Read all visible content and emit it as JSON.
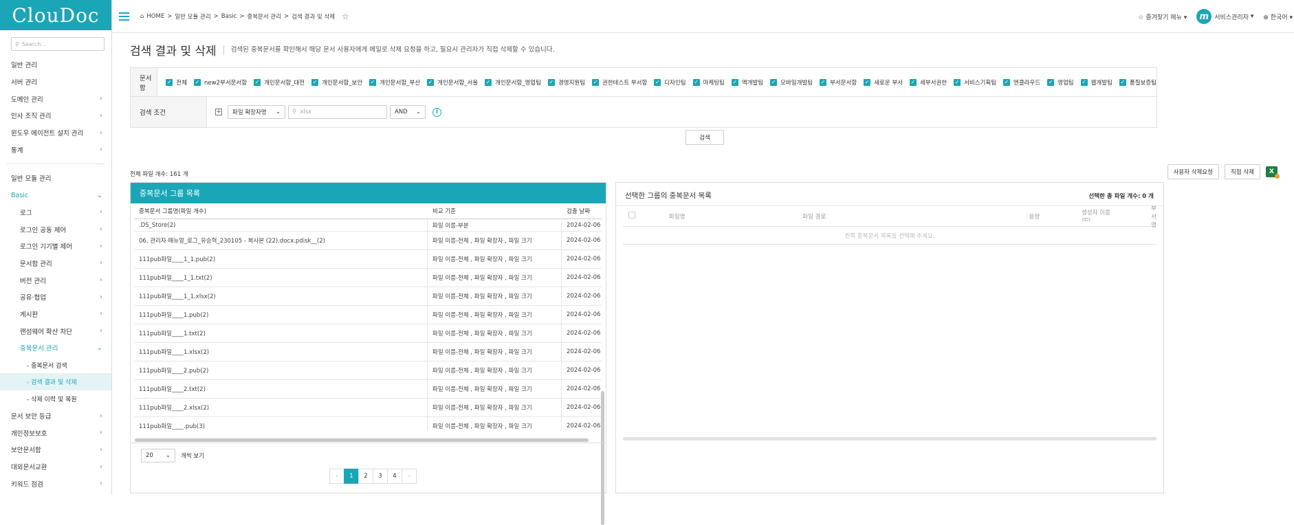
{
  "app": {
    "logo": "ClouDoc"
  },
  "sidebar": {
    "search_placeholder": "Search...",
    "items": [
      {
        "label": "일반 관리",
        "chevron": false
      },
      {
        "label": "서버 관리",
        "chevron": false
      },
      {
        "label": "도메인 관리",
        "chevron": true
      },
      {
        "label": "인사 조직 관리",
        "chevron": true
      },
      {
        "label": "윈도우 에이전트 설치 관리",
        "chevron": true
      },
      {
        "label": "통계",
        "chevron": true
      }
    ],
    "section2": "일반 모듈 관리",
    "basic": {
      "label": "Basic"
    },
    "basic_items": [
      {
        "label": "로그"
      },
      {
        "label": "로그인 공동 제어"
      },
      {
        "label": "로그인 기기별 제어"
      },
      {
        "label": "문서함 관리"
      },
      {
        "label": "버전 관리"
      },
      {
        "label": "공유·협업"
      },
      {
        "label": "게시판"
      },
      {
        "label": "랜섬웨어 확산 차단"
      }
    ],
    "dup": {
      "label": "중복문서 관리"
    },
    "dup_items": [
      "- 중복문서 검색",
      "- 검색 결과 및 삭제",
      "- 삭제 이력 및 복원"
    ],
    "bottom_items": [
      {
        "label": "문서 보안 등급"
      },
      {
        "label": "개인정보보호"
      },
      {
        "label": "보안문서함"
      },
      {
        "label": "대외문서교환"
      },
      {
        "label": "키워드 점검"
      }
    ]
  },
  "header": {
    "breadcrumb": [
      "HOME",
      ">",
      "일반 모듈 관리",
      ">",
      "Basic",
      ">",
      "중복문서 관리",
      ">",
      "검색 결과 및 삭제"
    ],
    "favorites": "즐겨찾기 메뉴",
    "avatar_letter": "m",
    "user": "서비스관리자",
    "language": "한국어"
  },
  "page": {
    "title": "검색 결과 및 삭제",
    "description": "검색된 중복문서를 확인해서 해당 문서 사용자에게 메일로 삭제 요청을 하고, 필요시 관리자가 직접 삭제할 수 있습니다."
  },
  "form": {
    "docbox_label": "문서함",
    "docboxes": [
      "전체",
      "new2부서문서함",
      "개인문서함_대전",
      "개인문서함_보안",
      "개인문서함_부산",
      "개인문서함_서울",
      "개인문서함_영업팀",
      "경영지원팀",
      "권한테스트 부서함",
      "디자인팀",
      "마케팅팀",
      "맥개발팀",
      "모바일개발팀",
      "부서문서함",
      "새로운 부서",
      "세부서권한",
      "서비스기획팀",
      "엔클라우드",
      "영업팀",
      "웹개발팀",
      "품질보증팀"
    ],
    "condition_label": "검색 조건",
    "field_select": "파일 확장자명",
    "value_placeholder": "xlsx",
    "operator_select": "AND",
    "search_button": "검색"
  },
  "results": {
    "total": "전체 파일 개수: 161 개",
    "request_delete_button": "사용자 삭제요청",
    "direct_delete_button": "직접 삭제",
    "excel_icon": "X"
  },
  "left_panel": {
    "title": "중복문서 그룹 목록",
    "columns": [
      "중복문서 그룹명(파일 개수)",
      "비교 기준",
      "검출 날짜"
    ],
    "rows": [
      [
        ".DS_Store(2)",
        "파일 이름-부분",
        "2024-02-06"
      ],
      [
        "06. 관리자 매뉴얼_로그_유승혁_230105 - 복사본 (22).docx.pdisk__(2)",
        "파일 이름-전체 , 파일 확장자 , 파일 크기",
        "2024-02-06"
      ],
      [
        "111pub파일____1_1.pub(2)",
        "파일 이름-전체 , 파일 확장자 , 파일 크기",
        "2024-02-06"
      ],
      [
        "111pub파일____1_1.txt(2)",
        "파일 이름-전체 , 파일 확장자 , 파일 크기",
        "2024-02-06"
      ],
      [
        "111pub파일____1_1.xlsx(2)",
        "파일 이름-전체 , 파일 확장자 , 파일 크기",
        "2024-02-06"
      ],
      [
        "111pub파일____1.pub(2)",
        "파일 이름-전체 , 파일 확장자 , 파일 크기",
        "2024-02-06"
      ],
      [
        "111pub파일____1.txt(2)",
        "파일 이름-전체 , 파일 확장자 , 파일 크기",
        "2024-02-06"
      ],
      [
        "111pub파일____1.xlsx(2)",
        "파일 이름-전체 , 파일 확장자 , 파일 크기",
        "2024-02-06"
      ],
      [
        "111pub파일____2.pub(2)",
        "파일 이름-전체 , 파일 확장자 , 파일 크기",
        "2024-02-06"
      ],
      [
        "111pub파일____2.txt(2)",
        "파일 이름-전체 , 파일 확장자 , 파일 크기",
        "2024-02-06"
      ],
      [
        "111pub파일____2.xlsx(2)",
        "파일 이름-전체 , 파일 확장자 , 파일 크기",
        "2024-02-06"
      ],
      [
        "111pub파일____.pub(3)",
        "파일 이름-전체 , 파일 확장자 , 파일 크기",
        "2024-02-06"
      ]
    ],
    "page_size": "20",
    "page_size_label": "개씩 보기",
    "pages": [
      "1",
      "2",
      "3",
      "4"
    ],
    "current_page": "1",
    "prev": "‹",
    "next": "›"
  },
  "right_panel": {
    "title": "선택한 그룹의 중복문서 목록",
    "count": "선택한 총 파일 개수: 0 개",
    "columns": [
      "파일명",
      "파일 경로",
      "용량",
      "생성자 이름",
      "(ID)",
      "부서명"
    ],
    "empty": "왼쪽 중복문서 목록을 선택해 주세요."
  },
  "colors": {
    "accent": "#1aa6b7",
    "excel": "#1e7e45"
  }
}
